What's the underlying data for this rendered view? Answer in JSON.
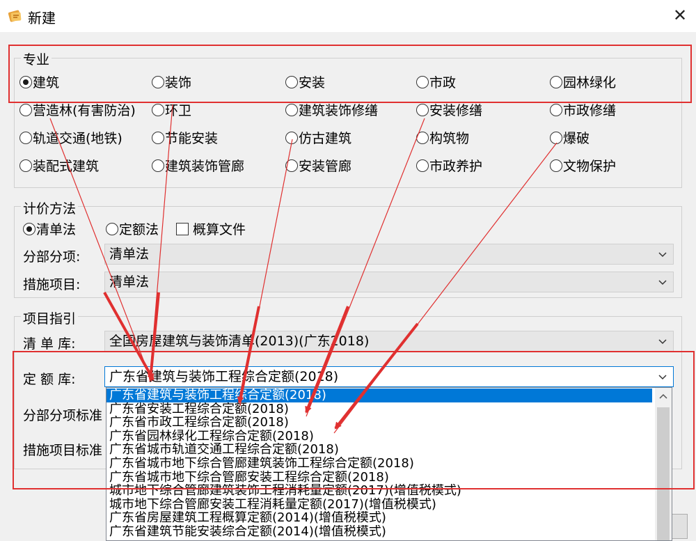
{
  "window": {
    "title": "新建",
    "close_glyph": "✕"
  },
  "major_group": {
    "title": "专业",
    "options": [
      {
        "label": "建筑",
        "checked": true
      },
      {
        "label": "装饰",
        "checked": false
      },
      {
        "label": "安装",
        "checked": false
      },
      {
        "label": "市政",
        "checked": false
      },
      {
        "label": "园林绿化",
        "checked": false
      },
      {
        "label": "营造林(有害防治)",
        "checked": false
      },
      {
        "label": "环卫",
        "checked": false
      },
      {
        "label": "建筑装饰修缮",
        "checked": false
      },
      {
        "label": "安装修缮",
        "checked": false
      },
      {
        "label": "市政修缮",
        "checked": false
      },
      {
        "label": "轨道交通(地铁)",
        "checked": false
      },
      {
        "label": "节能安装",
        "checked": false
      },
      {
        "label": "仿古建筑",
        "checked": false
      },
      {
        "label": "构筑物",
        "checked": false
      },
      {
        "label": "爆破",
        "checked": false
      },
      {
        "label": "装配式建筑",
        "checked": false
      },
      {
        "label": "建筑装饰管廊",
        "checked": false
      },
      {
        "label": "安装管廊",
        "checked": false
      },
      {
        "label": "市政养护",
        "checked": false
      },
      {
        "label": "文物保护",
        "checked": false
      }
    ]
  },
  "pricing_group": {
    "title": "计价方法",
    "methods": [
      {
        "label": "清单法",
        "checked": true
      },
      {
        "label": "定额法",
        "checked": false
      }
    ],
    "estimate_checkbox": {
      "label": "概算文件",
      "checked": false
    },
    "subitem_label": "分部分项:",
    "subitem_value": "清单法",
    "measure_label": "措施项目:",
    "measure_value": "清单法"
  },
  "guide_group": {
    "title": "项目指引",
    "bill_library_label": "清 单 库:",
    "bill_library_value": "全国房屋建筑与装饰清单(2013)(广东2018)",
    "quota_library_label": "定 额 库:",
    "quota_library_value": "广东省建筑与装饰工程综合定额(2018)",
    "subitem_std_label": "分部分项标准",
    "measure_std_label": "措施项目标准"
  },
  "quota_dropdown": {
    "items": [
      "广东省建筑与装饰工程综合定额(2018)",
      "广东省安装工程综合定额(2018)",
      "广东省市政工程综合定额(2018)",
      "广东省园林绿化工程综合定额(2018)",
      "广东省城市轨道交通工程综合定额(2018)",
      "广东省城市地下综合管廊建筑装饰工程综合定额(2018)",
      "广东省城市地下综合管廊安装工程综合定额(2018)",
      "城市地下综合管廊建筑装饰工程消耗量定额(2017)(增值税模式)",
      "城市地下综合管廊安装工程消耗量定额(2017)(增值税模式)",
      "广东省房屋建筑工程概算定额(2014)(增值税模式)",
      "广东省建筑节能安装综合定额(2014)(增值税模式)"
    ],
    "selected_index": 0
  },
  "colors": {
    "annotation": "#e03030",
    "selection": "#0078d7"
  }
}
